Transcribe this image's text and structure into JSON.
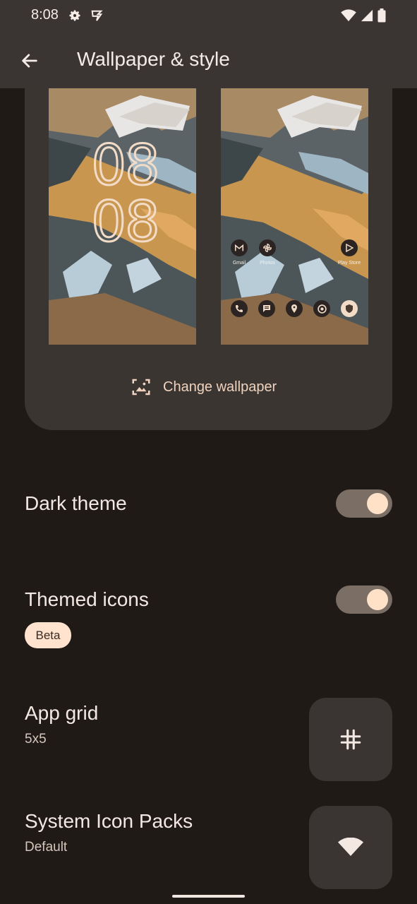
{
  "status_bar": {
    "time": "8:08"
  },
  "header": {
    "title": "Wallpaper & style"
  },
  "preview": {
    "clock_line1": "08",
    "clock_line2": "08",
    "apps_top": [
      {
        "label": "Gmail",
        "icon": "gmail-icon"
      },
      {
        "label": "Photos",
        "icon": "photos-icon"
      },
      {
        "label": "Play Store",
        "icon": "play-store-icon"
      }
    ],
    "dock_icons": [
      "phone-icon",
      "messages-icon",
      "maps-icon",
      "chrome-icon",
      "shield-icon"
    ],
    "change_wallpaper_label": "Change wallpaper"
  },
  "settings": {
    "dark_theme": {
      "label": "Dark theme",
      "enabled": true
    },
    "themed_icons": {
      "label": "Themed icons",
      "badge": "Beta",
      "enabled": true
    },
    "app_grid": {
      "label": "App grid",
      "value": "5x5"
    },
    "icon_packs": {
      "label": "System Icon Packs",
      "value": "Default"
    }
  },
  "colors": {
    "background": "#201a17",
    "surface": "#3a3432",
    "accent": "#f0d3bf",
    "toggle_track": "#7a6e65",
    "toggle_knob": "#ffe1c8"
  }
}
